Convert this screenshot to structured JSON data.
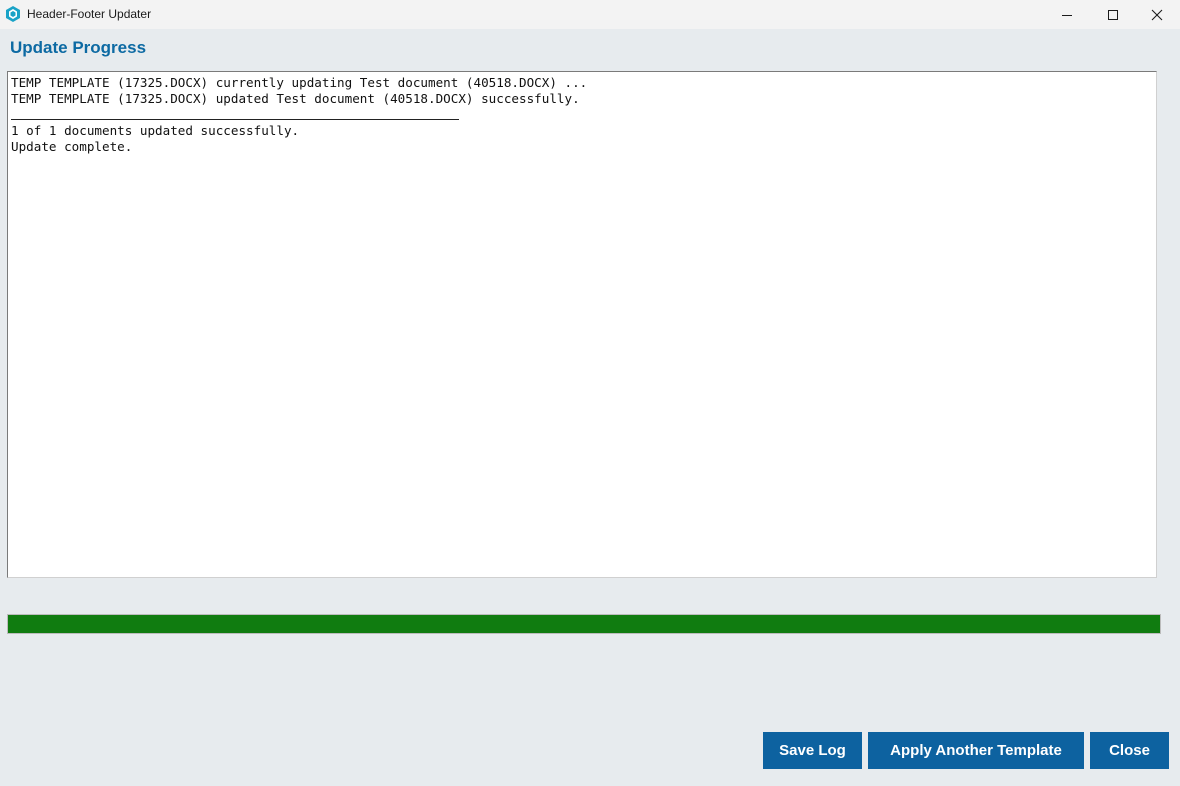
{
  "window": {
    "title": "Header-Footer Updater",
    "icon": "hexagon-logo-icon",
    "controls": [
      "minimize-icon",
      "maximize-icon",
      "close-icon"
    ]
  },
  "page": {
    "title": "Update Progress"
  },
  "log": {
    "lines": [
      "TEMP TEMPLATE (17325.DOCX) currently updating Test document (40518.DOCX) ...",
      "TEMP TEMPLATE (17325.DOCX) updated Test document (40518.DOCX) successfully.",
      "1 of 1 documents updated successfully.",
      "Update complete."
    ]
  },
  "progress": {
    "percent": 100,
    "color": "#107c10"
  },
  "buttons": {
    "save_log": "Save Log",
    "apply_another": "Apply Another Template",
    "close": "Close"
  },
  "colors": {
    "accent": "#0d6aa3",
    "button_bg": "#0d62a0",
    "background": "#e7ebee"
  }
}
